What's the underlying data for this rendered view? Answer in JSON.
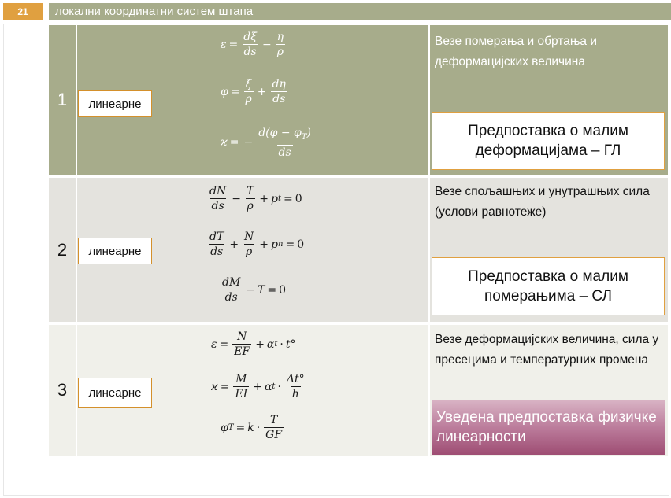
{
  "header": {
    "slide_number": "21",
    "title": "локални координатни систем штапа"
  },
  "rows": [
    {
      "number": "1",
      "type_label": "линеарне",
      "description": "Везе померања и обртања и деформацијских величина",
      "assumption": "Предпоставка о малим деформацијама – ГЛ",
      "equations": {
        "eq1": {
          "lhs": "ε",
          "f1n": "dξ",
          "f1d": "ds",
          "f2n": "η",
          "f2d": "ρ"
        },
        "eq2": {
          "lhs": "φ",
          "f1n": "ξ",
          "f1d": "ρ",
          "f2n": "dη",
          "f2d": "ds"
        },
        "eq3": {
          "lhs": "ϰ",
          "f1n": "d(φ − φ",
          "f1n_sub": "T",
          "f1d": "ds"
        }
      }
    },
    {
      "number": "2",
      "type_label": "линеарне",
      "description": "Везе спољашњих и унутрашњих сила (услови равнотеже)",
      "assumption": "Предпоставка о малим померањима – СЛ",
      "equations": {
        "eq1": {
          "f1n": "dN",
          "f1d": "ds",
          "f2n": "T",
          "f2d": "ρ",
          "p": "p",
          "p_sub": "t",
          "rhs": "0"
        },
        "eq2": {
          "f1n": "dT",
          "f1d": "ds",
          "f2n": "N",
          "f2d": "ρ",
          "p": "p",
          "p_sub": "n",
          "rhs": "0"
        },
        "eq3": {
          "f1n": "dM",
          "f1d": "ds",
          "t": "T",
          "rhs": "0"
        }
      }
    },
    {
      "number": "3",
      "type_label": "линеарне",
      "description": "Везе деформацијских величина, сила у пресецима и температурних промена",
      "assumption": "Уведена предпоставка физичке линеарности",
      "equations": {
        "eq1": {
          "lhs": "ε",
          "f1n": "N",
          "f1d": "EF",
          "alpha": "α",
          "alpha_sub": "t",
          "tail": "t°"
        },
        "eq2": {
          "lhs": "ϰ",
          "f1n": "M",
          "f1d": "EI",
          "alpha": "α",
          "alpha_sub": "t",
          "f2n": "Δt°",
          "f2d": "h"
        },
        "eq3": {
          "lhs": "φ",
          "lhs_sub": "T",
          "k": "k",
          "f1n": "T",
          "f1d": "GF"
        }
      }
    }
  ],
  "colors": {
    "badge": "#E0A040",
    "title_bar": "#A7AC8B",
    "row1": "#A7AC8B",
    "row2": "#E4E3DE",
    "row3": "#F0F0EA",
    "box_border": "#E0A040",
    "pink_box": "#B97898"
  }
}
